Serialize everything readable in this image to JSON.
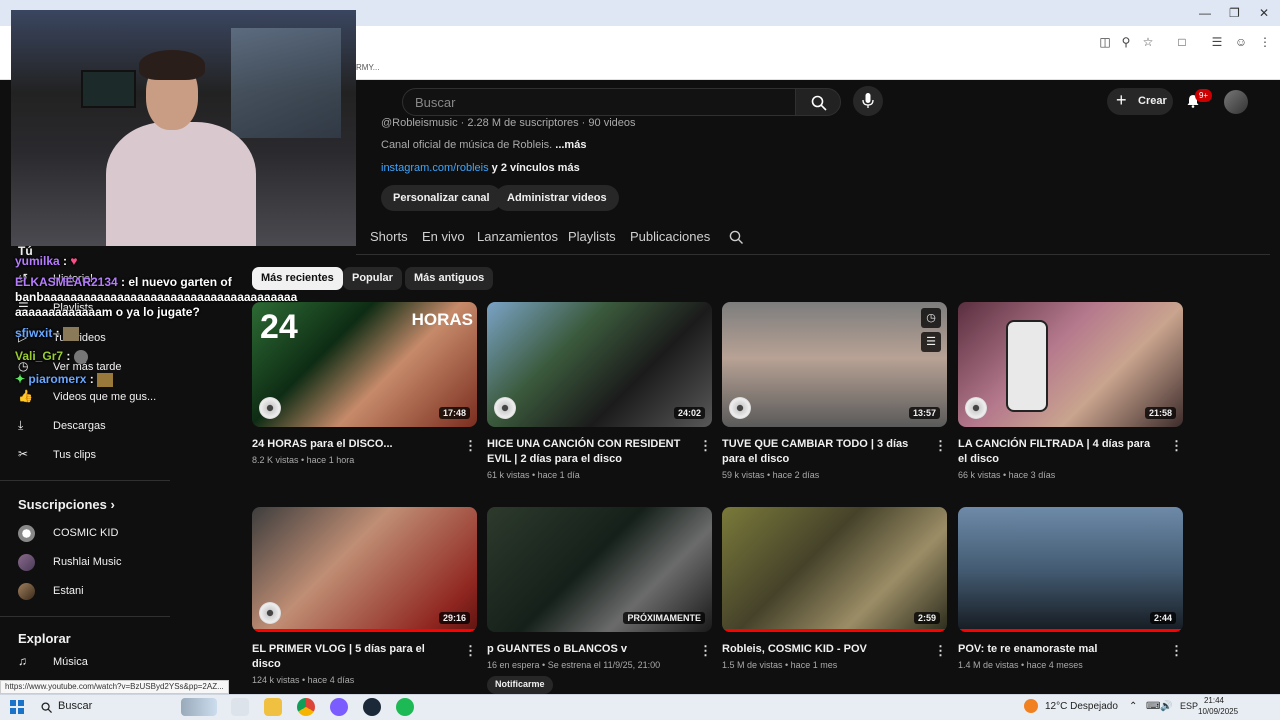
{
  "browser": {
    "bookmark_fragment": "RMY...",
    "status_url": "https://www.youtube.com/watch?v=BzUSByd2YSs&pp=2AZ..."
  },
  "header": {
    "search_placeholder": "Buscar",
    "create_label": "Crear",
    "notifications_badge": "9+"
  },
  "channel": {
    "handle_line": "@Robleismusic · 2.28 M de suscriptores · 90 videos",
    "description": "Canal oficial de música de Robleis.",
    "more_label": "...más",
    "link": "instagram.com/robleis",
    "links_suffix": "y 2 vínculos más",
    "customize_label": "Personalizar canal",
    "manage_label": "Administrar videos"
  },
  "tabs": [
    "Shorts",
    "En vivo",
    "Lanzamientos",
    "Playlists",
    "Publicaciones"
  ],
  "chips": [
    "Más recientes",
    "Popular",
    "Más antiguos"
  ],
  "videos": [
    {
      "title": "24 HORAS para el DISCO...",
      "meta": "8.2 K vistas • hace 1 hora",
      "duration": "17:48",
      "progress": 0.0
    },
    {
      "title": "HICE UNA CANCIÓN CON RESIDENT EVIL | 2 días para el disco",
      "meta": "61 k vistas • hace 1 día",
      "duration": "24:02",
      "progress": 0.0
    },
    {
      "title": "TUVE QUE CAMBIAR TODO | 3 días para el disco",
      "meta": "59 k vistas • hace 2 días",
      "duration": "13:57",
      "progress": 0.0
    },
    {
      "title": "LA CANCIÓN FILTRADA | 4 días para el disco",
      "meta": "66 k vistas • hace 3 días",
      "duration": "21:58",
      "progress": 0.0
    },
    {
      "title": "EL PRIMER VLOG | 5 días para el disco",
      "meta": "124 k vistas • hace 4 días",
      "duration": "29:16",
      "progress": 1.0
    },
    {
      "title": "p GUANTES o BLANCOS v",
      "meta": "16 en espera • Se estrena el 11/9/25, 21:00",
      "duration": "PRÓXIMAMENTE",
      "progress": 0.0,
      "notify_label": "Notificarme"
    },
    {
      "title": "Robleis, COSMIC KID - POV",
      "meta": "1.5 M de vistas • hace 1 mes",
      "duration": "2:59",
      "progress": 1.0
    },
    {
      "title": "POV: te re enamoraste mal",
      "meta": "1.4 M de vistas • hace 4 meses",
      "duration": "2:44",
      "progress": 1.0
    }
  ],
  "sidebar": {
    "you_label": "Tú",
    "items": [
      {
        "label": "Historial",
        "icon": "history-icon"
      },
      {
        "label": "Playlists",
        "icon": "playlist-icon"
      },
      {
        "label": "Tus videos",
        "icon": "your-videos-icon"
      },
      {
        "label": "Ver más tarde",
        "icon": "watch-later-icon"
      },
      {
        "label": "Videos que me gus...",
        "icon": "thumbs-up-icon"
      },
      {
        "label": "Descargas",
        "icon": "download-icon"
      },
      {
        "label": "Tus clips",
        "icon": "scissors-icon"
      }
    ],
    "subscriptions_label": "Suscripciones",
    "subscriptions": [
      "COSMIC KID",
      "Rushlai Music",
      "Estani"
    ],
    "explore_label": "Explorar",
    "explore_items": [
      "Música"
    ]
  },
  "chat": [
    {
      "user": "yumilka",
      "text": ""
    },
    {
      "user": "ELKASMEAR2134",
      "text": "el nuevo garten of banbaaaaaaaaaaaaaaaaaaaaaaaaaaaaaaaaaaaaaa aaaaaaaaaaaaam o ya lo jugate?"
    },
    {
      "user": "sfiwxit",
      "text": ""
    },
    {
      "user": "Vali_Gr7",
      "text": ""
    },
    {
      "user": "piaromerx",
      "text": ""
    }
  ],
  "taskbar": {
    "search_label": "Buscar",
    "weather": "12°C  Despejado",
    "lang": "ESP",
    "time": "21:44",
    "date": "10/09/2025"
  },
  "colors": {
    "background": "#0f0f0f",
    "accent_red": "#ff0000",
    "link_blue": "#3ea6ff"
  }
}
